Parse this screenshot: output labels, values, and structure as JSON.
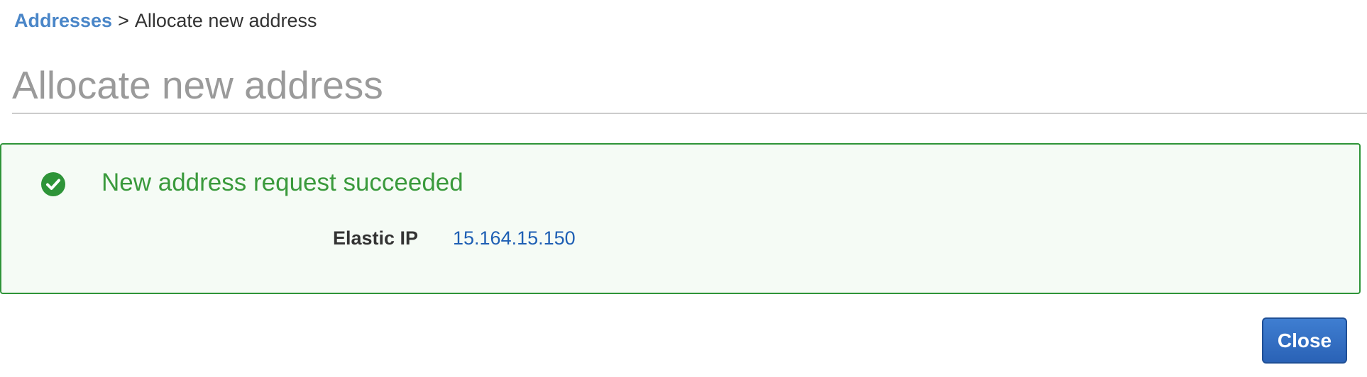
{
  "breadcrumb": {
    "parent_label": "Addresses",
    "separator": ">",
    "current_label": "Allocate new address"
  },
  "page": {
    "title": "Allocate new address"
  },
  "success_panel": {
    "icon": "check-circle-icon",
    "message": "New address request succeeded",
    "field_label": "Elastic IP",
    "field_value": "15.164.15.150"
  },
  "actions": {
    "close_label": "Close"
  },
  "colors": {
    "link": "#4a86c8",
    "success": "#3a9a3c",
    "success_border": "#2e9438",
    "success_bg": "#f5fbf5",
    "primary_button": "#2f6fc6",
    "ip_link": "#1e5fb4"
  }
}
